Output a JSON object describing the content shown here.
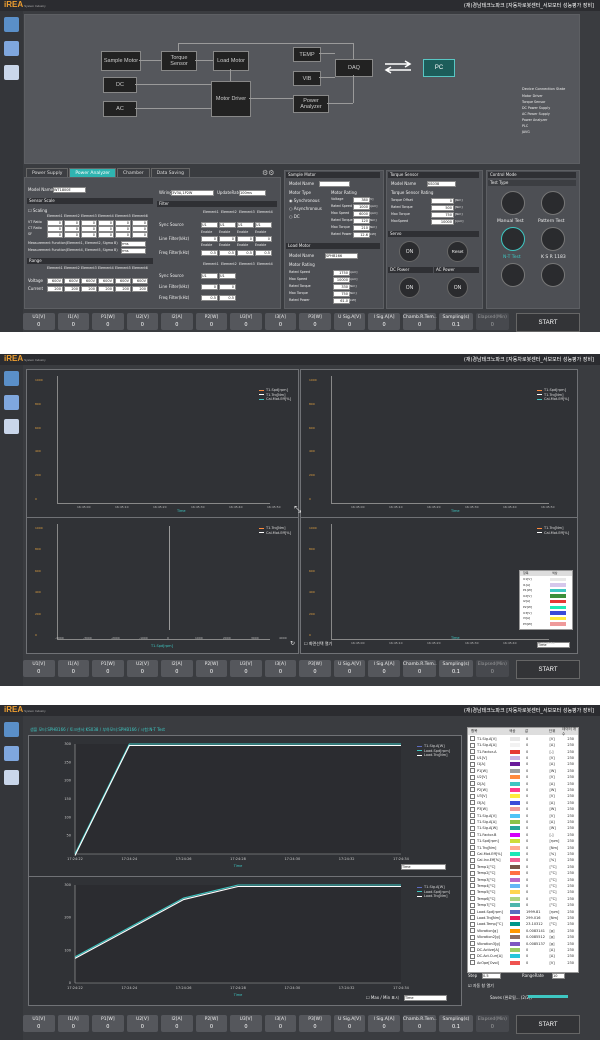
{
  "app": {
    "logo": "iREA",
    "logo_sub": "System Industry",
    "user": "(재)경남테크노파크 [자동차로봇센터_서보모터 성능평가 장비]"
  },
  "screen1": {
    "diagram": {
      "sample_motor": "Sample Motor",
      "torque_sensor": "Torque Sensor",
      "load_motor": "Load Motor",
      "dc": "DC",
      "ac": "AC",
      "motor_driver": "Motor Driver",
      "temp": "TEMP",
      "vib": "VIB",
      "power_analyzer": "Power Analyzer",
      "daq": "DAQ",
      "pc": "PC"
    },
    "device_state": {
      "title": "Device Connection State",
      "items": [
        "Motor Driver",
        "Torque Sensor",
        "DC Power Supply",
        "AC Power Supply",
        "Power Analyzer",
        "PLC",
        "JAVG"
      ]
    },
    "tabs": [
      "Power Supply",
      "Power Analyzer",
      "Chamber",
      "Data Saving"
    ],
    "pa": {
      "model_name_label": "Model Name",
      "model_name": "WT1800E",
      "sensor_scale": "Sensor Scale",
      "scaling": "Scaling",
      "elements": [
        "Element1",
        "Element2",
        "Element3",
        "Element4",
        "Element5",
        "Element6"
      ],
      "rows": [
        "VT Ratio",
        "CT Ratio",
        "SF"
      ],
      "mf1": "Measurement Function(Element1, Element2, Sigma B)",
      "mf2": "Measurement Function(Element4, Element5, Sigma B)",
      "mf_val": "rms",
      "range": "Range",
      "voltage": "Voltage",
      "current": "Current",
      "voltage_val": "600V",
      "current_val": "200",
      "wiring_label": "Wiring",
      "wiring_val": "3V3A,1P2W",
      "update_label": "UpdateRate",
      "update_val": "100ms",
      "filter": "Filter",
      "sync_source": "Sync Source",
      "line_filter": "Line Filter(kHz)",
      "freq_filter": "Freq Filter(kHz)",
      "enable": "Enable",
      "u1": "U1",
      "zero": "0",
      "half": "0.5"
    },
    "sample_motor": {
      "title": "Sample Motor",
      "model_name": "Model Name",
      "motor_type": "Motor Type",
      "synchronous": "Synchronous",
      "asynchronous": "Asynchronous",
      "dc": "DC",
      "motor_rating": "Motor Rating",
      "rating_labels": [
        "Voltage",
        "Rated Speed",
        "Max Speed",
        "Rated Torque",
        "Max Torque",
        "Rated Power"
      ],
      "rating_values": [
        "380",
        "1000",
        "6000",
        "120",
        "210",
        "12.6"
      ],
      "rating_units": [
        "[V]",
        "[rpm]",
        "[rpm]",
        "[Nm]",
        "[Nm]",
        "[kW]"
      ]
    },
    "load_motor": {
      "title": "Load Motor",
      "model_name": "Model Name",
      "model_val": "SPHB166",
      "motor_rating": "Motor Rating",
      "rating_labels": [
        "Rated Speed",
        "Max Speed",
        "Rated Torque",
        "Max Torque",
        "Rated Power"
      ],
      "rating_values": [
        "1750",
        "10000",
        "330",
        "750",
        "61.0"
      ],
      "rating_units": [
        "[rpm]",
        "[rpm]",
        "[Nm]",
        "[Nm]",
        "[kW]"
      ]
    },
    "torque_sensor": {
      "title": "Torque Sensor",
      "model_name": "Model Name",
      "model_val": "KS038",
      "rating": "Torque Sensor Rating",
      "labels": [
        "Torque Offset",
        "Rated Torque",
        "Max Torque",
        "MaxSpeed"
      ],
      "values": [
        "0",
        "500",
        "750",
        "10000"
      ],
      "units": [
        "[Nm]",
        "[Nm]",
        "[Nm]",
        "[rpm]"
      ]
    },
    "servo": {
      "title": "Servo",
      "on": "ON",
      "reset": "Reset"
    },
    "dc_power": {
      "title": "DC Power",
      "on": "ON"
    },
    "ac_power": {
      "title": "AC Power",
      "on": "ON"
    },
    "control_mode": {
      "title": "Control Mode",
      "test_type": "Test Type",
      "items": [
        "Manual Test",
        "Pattern Test",
        "N-T Test",
        "K S R 1183"
      ]
    }
  },
  "status": {
    "items": [
      {
        "title": "U1[V]",
        "value": "0"
      },
      {
        "title": "I1[A]",
        "value": "0"
      },
      {
        "title": "P1[W]",
        "value": "0"
      },
      {
        "title": "U2[V]",
        "value": "0"
      },
      {
        "title": "I2[A]",
        "value": "0"
      },
      {
        "title": "P2[W]",
        "value": "0"
      },
      {
        "title": "U3[V]",
        "value": "0"
      },
      {
        "title": "I3[A]",
        "value": "0"
      },
      {
        "title": "P3[W]",
        "value": "0"
      },
      {
        "title": "U Sig.A[V]",
        "value": "0"
      },
      {
        "title": "I Sig.A[A]",
        "value": "0"
      },
      {
        "title": "Chamb.R.Tem..",
        "value": "0"
      },
      {
        "title": "Sampling(s)",
        "value": "0.1"
      },
      {
        "title": "Elapsed(Min)",
        "value": "0"
      }
    ],
    "start": "START"
  },
  "screen2": {
    "legend_a": [
      "T1.Spd[rpm]",
      "T1.Trq[Nm]",
      "Cal.Mot.Eff[%]"
    ],
    "legend_c": [
      "T1.Trq[Nm]",
      "Cal.Mot.Eff[%]"
    ],
    "time_label": "Time",
    "x_label_c": "T1.Spd[rpm]",
    "time_ticks": [
      "16:45:00",
      "16:45:10",
      "16:45:20",
      "16:45:30",
      "16:45:40",
      "16:45:50"
    ],
    "spd_ticks": [
      "-4000",
      "-3000",
      "-2000",
      "-1000",
      "0",
      "1000",
      "2000",
      "3000",
      "4000"
    ],
    "y_ticks": [
      "1000",
      "800",
      "600",
      "400",
      "200",
      "0"
    ],
    "popup": {
      "header": [
        "항목",
        "색상"
      ],
      "items": [
        "U1[V]",
        "I1[A]",
        "P1[W]",
        "U2[V]",
        "I2[A]",
        "P2[W]",
        "U3[V]",
        "I3[A]",
        "P3[W]"
      ]
    },
    "checkbox": "화면선택 열기",
    "time_select": "Time"
  },
  "screen3": {
    "info": "샘플 모터:SPHB166 / 토크센서:KS038 / 부하모터:SPHB166 / 시험:N-T Test",
    "legend_top": [
      "T1.Sig.A[W]",
      "Load.Spd[rpm]",
      "Load.Trq[Nm]"
    ],
    "legend_bottom": [
      "T1.Sig.A[W]",
      "Load.Spd[rpm]",
      "Load.Trq[Nm]"
    ],
    "y_top": [
      "300",
      "250",
      "200",
      "150",
      "100",
      "50"
    ],
    "y_bottom": [
      "300",
      "200",
      "100",
      "0"
    ],
    "x_ticks": [
      "17:24:22",
      "17:24:24",
      "17:24:26",
      "17:24:28",
      "17:24:30",
      "17:24:32",
      "17:24:34"
    ],
    "time_label": "Time",
    "time_select": "Time",
    "max_min": "Max / Min 표시",
    "table_header": [
      "항목",
      "색상",
      "값",
      "단위",
      "데이터 개수"
    ],
    "signals": [
      {
        "name": "T1.Sig.A[V]",
        "color": "#e8e8e8",
        "value": "0",
        "unit": "[V]",
        "count": "230"
      },
      {
        "name": "T1.Sig.A[A]",
        "color": "#f2f2f2",
        "value": "0",
        "unit": "[A]",
        "count": "230"
      },
      {
        "name": "T1.Factor-A",
        "color": "#e53935",
        "value": "0",
        "unit": "[-]",
        "count": "230"
      },
      {
        "name": "U1[V]",
        "color": "#c9b3e6",
        "value": "0",
        "unit": "[V]",
        "count": "230"
      },
      {
        "name": "I1[A]",
        "color": "#6a1b9a",
        "value": "0",
        "unit": "[A]",
        "count": "230"
      },
      {
        "name": "P1[W]",
        "color": "#9e9e9e",
        "value": "0",
        "unit": "[W]",
        "count": "230"
      },
      {
        "name": "U2[V]",
        "color": "#ff8a3d",
        "value": "0",
        "unit": "[V]",
        "count": "230"
      },
      {
        "name": "I2[A]",
        "color": "#3ec7c2",
        "value": "0",
        "unit": "[A]",
        "count": "230"
      },
      {
        "name": "P2[W]",
        "color": "#ff3d8a",
        "value": "0",
        "unit": "[W]",
        "count": "230"
      },
      {
        "name": "U3[V]",
        "color": "#ffeb3b",
        "value": "0",
        "unit": "[V]",
        "count": "230"
      },
      {
        "name": "I3[A]",
        "color": "#3b4bd8",
        "value": "0",
        "unit": "[A]",
        "count": "230"
      },
      {
        "name": "P3[W]",
        "color": "#ef9a9a",
        "value": "0",
        "unit": "[W]",
        "count": "230"
      },
      {
        "name": "T1.Sig.A[V]",
        "color": "#4fc3f7",
        "value": "0",
        "unit": "[V]",
        "count": "230"
      },
      {
        "name": "T1.Sig.A[A]",
        "color": "#8bc34a",
        "value": "0",
        "unit": "[A]",
        "count": "230"
      },
      {
        "name": "T1.Sig.A[W]",
        "color": "#26a69a",
        "value": "0",
        "unit": "[W]",
        "count": "230"
      },
      {
        "name": "T1.Factor-B",
        "color": "#d500f9",
        "value": "0",
        "unit": "[-]",
        "count": "230"
      },
      {
        "name": "T1.Spd[rpm]",
        "color": "#cddc39",
        "value": "0",
        "unit": "[rpm]",
        "count": "230"
      },
      {
        "name": "T1.Trq[Nm]",
        "color": "#ffab91",
        "value": "0",
        "unit": "[Nm]",
        "count": "230"
      },
      {
        "name": "Cal.Mot.Eff[%]",
        "color": "#1de9b6",
        "value": "0",
        "unit": "[%]",
        "count": "230"
      },
      {
        "name": "Cal.Inv.Eff[%]",
        "color": "#f06292",
        "value": "0",
        "unit": "[%]",
        "count": "230"
      },
      {
        "name": "Temp1[°C]",
        "color": "#795548",
        "value": "0",
        "unit": "[°C]",
        "count": "230"
      },
      {
        "name": "Temp2[°C]",
        "color": "#ff7043",
        "value": "0",
        "unit": "[°C]",
        "count": "230"
      },
      {
        "name": "Temp3[°C]",
        "color": "#ba68c8",
        "value": "0",
        "unit": "[°C]",
        "count": "230"
      },
      {
        "name": "Temp4[°C]",
        "color": "#64b5f6",
        "value": "0",
        "unit": "[°C]",
        "count": "230"
      },
      {
        "name": "Temp5[°C]",
        "color": "#ffd54f",
        "value": "0",
        "unit": "[°C]",
        "count": "230"
      },
      {
        "name": "Temp6[°C]",
        "color": "#aed581",
        "value": "0",
        "unit": "[°C]",
        "count": "230"
      },
      {
        "name": "Temp7[°C]",
        "color": "#4db6ac",
        "value": "0",
        "unit": "[°C]",
        "count": "230"
      },
      {
        "name": "Load.Spd[rpm]",
        "color": "#5c6bc0",
        "value": "1999.81",
        "unit": "[rpm]",
        "count": "230"
      },
      {
        "name": "Load.Trq[Nm]",
        "color": "#e91e63",
        "value": "299.016",
        "unit": "[Nm]",
        "count": "230"
      },
      {
        "name": "Load.Temp[°C]",
        "color": "#009688",
        "value": "23.10312",
        "unit": "[°C]",
        "count": "230"
      },
      {
        "name": "Vibration[g]",
        "color": "#ff9800",
        "value": "0.0083141",
        "unit": "[g]",
        "count": "230"
      },
      {
        "name": "Vibration2[g]",
        "color": "#8d6e63",
        "value": "0.0085512",
        "unit": "[g]",
        "count": "230"
      },
      {
        "name": "Vibration3[g]",
        "color": "#7e57c2",
        "value": "0.0085137",
        "unit": "[g]",
        "count": "230"
      },
      {
        "name": "DC.Active[A]",
        "color": "#9ccc65",
        "value": "0",
        "unit": "[A]",
        "count": "230"
      },
      {
        "name": "DC.Act.Curr[A]",
        "color": "#26c6da",
        "value": "0",
        "unit": "[A]",
        "count": "230"
      },
      {
        "name": "AcOpe[Ovol]",
        "color": "#ef5350",
        "value": "0",
        "unit": "[V]",
        "count": "230"
      }
    ],
    "step_label": "Step",
    "step_val": "0.5",
    "range_label": "RangeRate",
    "range_val": "10",
    "auto_open": "자동 창 열기",
    "saves": "Saves (완료됨... (2/2))"
  },
  "chart_data": [
    {
      "type": "line",
      "title": "",
      "xlabel": "Time",
      "ylabel": "",
      "x": [
        "17:24:22",
        "17:24:24",
        "17:24:26",
        "17:24:28",
        "17:24:30",
        "17:24:32",
        "17:24:34"
      ],
      "ylim": [
        0,
        300
      ],
      "series": [
        {
          "name": "Load.Spd[rpm]",
          "values": [
            0,
            300,
            300,
            300,
            300,
            300,
            300
          ]
        },
        {
          "name": "Load.Trq[Nm]",
          "values": [
            0,
            300,
            300,
            300,
            300,
            300,
            300
          ]
        }
      ]
    },
    {
      "type": "line",
      "title": "",
      "xlabel": "Time",
      "ylabel": "",
      "x": [
        "17:24:22",
        "17:24:24",
        "17:24:26",
        "17:24:28",
        "17:24:30",
        "17:24:32",
        "17:24:34"
      ],
      "ylim": [
        0,
        300
      ],
      "series": [
        {
          "name": "Load.Spd[rpm]",
          "values": [
            80,
            170,
            260,
            300,
            300,
            300,
            300
          ]
        },
        {
          "name": "Load.Trq[Nm]",
          "values": [
            80,
            170,
            260,
            300,
            300,
            300,
            300
          ]
        }
      ]
    }
  ]
}
